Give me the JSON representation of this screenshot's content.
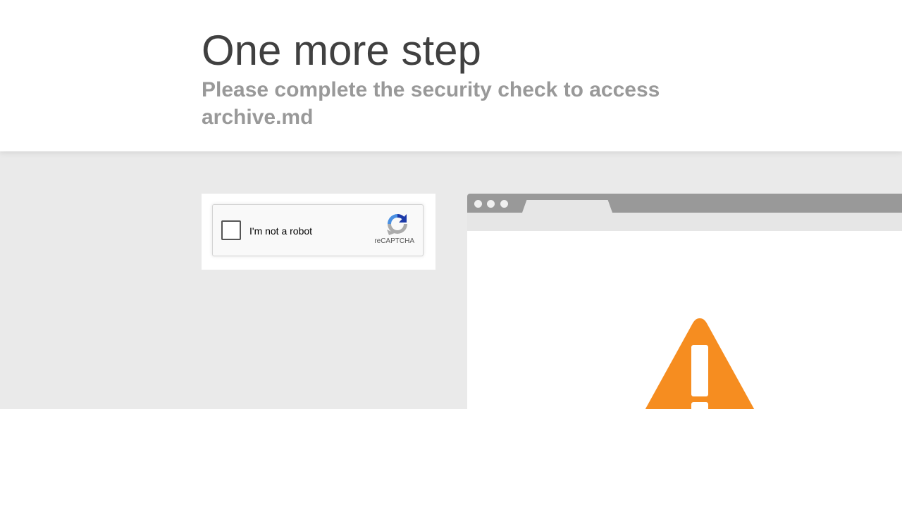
{
  "header": {
    "title": "One more step",
    "subtitle": "Please complete the security check to access archive.md"
  },
  "captcha": {
    "checkbox_label": "I'm not a robot",
    "brand_label": "reCAPTCHA",
    "checked": false
  },
  "browser_illustration": {
    "icon": "warning-icon"
  },
  "colors": {
    "band_background": "#eaeaea",
    "warning": "#f68d20",
    "title": "#404040",
    "subtitle": "#999999"
  }
}
